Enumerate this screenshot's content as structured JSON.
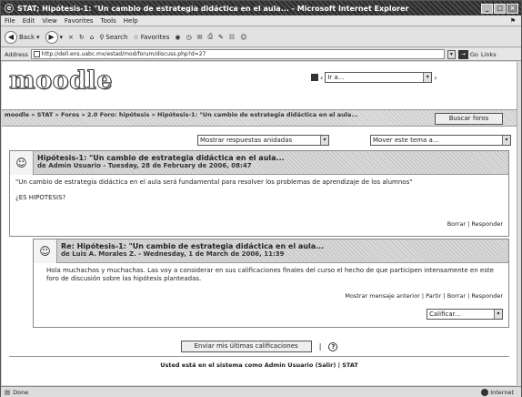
{
  "window": {
    "title": "STAT; Hipótesis-1: \"Un cambio de estrategia didáctica en el aula... - Microsoft Internet Explorer"
  },
  "menu": [
    "File",
    "Edit",
    "View",
    "Favorites",
    "Tools",
    "Help"
  ],
  "toolbar": {
    "back": "Back",
    "search": "Search",
    "favorites": "Favorites"
  },
  "address": {
    "label": "Address",
    "url": "http://dell.ens.uabc.mx/estad/mod/forum/discuss.php?d=27",
    "go": "Go",
    "links": "Links"
  },
  "header": {
    "logo": "moodle",
    "jump_value": "Ir a..."
  },
  "navbar": {
    "breadcrumb": "moodle » STAT » Foros » 2.0 Foro: hipótesis » Hipótesis-1: \"Un cambio de estrategia didáctica en el aula...",
    "search_button": "Buscar foros"
  },
  "controls": {
    "display_mode": "Mostrar respuestas anidadas",
    "move_to": "Mover este tema a..."
  },
  "posts": [
    {
      "subject": "Hipótesis-1: \"Un cambio de estrategia didáctica en el aula...",
      "author": "de Admin Usuario - Tuesday, 28 de February de 2006, 08:47",
      "body": "\"Un cambio de estrategia didáctica en el aula será fundamental para resolver los problemas de aprendizaje de los alumnos\"",
      "question": "¿ES HIPOTESIS?",
      "commands": "Borrar | Responder"
    },
    {
      "subject": "Re: Hipótesis-1: \"Un cambio de estrategia didáctica en el aula...",
      "author": "de Luis A. Morales Z. - Wednesday, 1 de March de 2006, 11:39",
      "body": "Hola muchachos y muchachas. Las voy a considerar en sus calificaciones finales del curso el hecho de que participen intensamente en este foro de discusión sobre las hipótesis planteadas.",
      "commands": "Mostrar mensaje anterior | Partir | Borrar | Responder",
      "rating": "Calificar..."
    }
  ],
  "actions": {
    "send_ratings": "Enviar mis últimas calificaciones"
  },
  "footer": {
    "login_info": "Usted está en el sistema como Admin Usuario (Salir) | STAT"
  },
  "status": {
    "left": "Done",
    "zone": "Internet"
  }
}
